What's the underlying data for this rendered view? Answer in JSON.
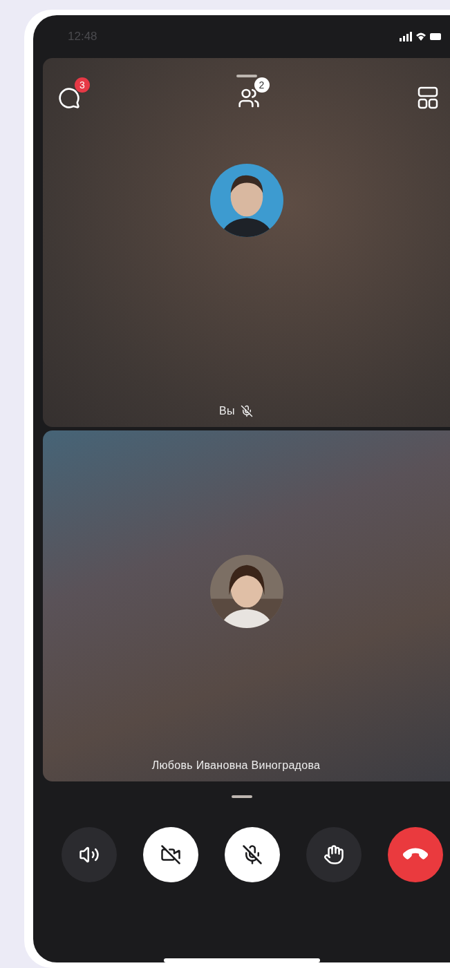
{
  "status_bar": {
    "time": "12:48"
  },
  "top_bar": {
    "chat_badge": "3",
    "participants_badge": "2"
  },
  "tiles": [
    {
      "kind": "self",
      "name": "Вы",
      "muted": true
    },
    {
      "kind": "remote",
      "name": "Любовь Ивановна Виноградова",
      "muted": false
    }
  ],
  "controls": [
    {
      "kind": "speaker",
      "highlighted": false
    },
    {
      "kind": "camera-off",
      "highlighted": true
    },
    {
      "kind": "mic-off",
      "highlighted": true
    },
    {
      "kind": "hand",
      "highlighted": false
    },
    {
      "kind": "end-call"
    }
  ]
}
